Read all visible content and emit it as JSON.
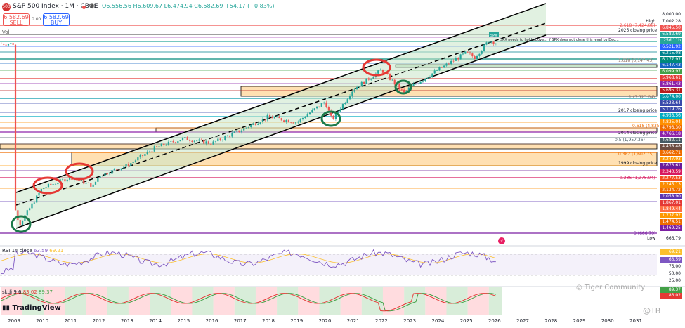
{
  "header": {
    "symbol_icon": "500",
    "title": "S&P 500 Index · 1M · CBOE",
    "ohlc": "O6,556.56  H6,609.67  L6,474.94  C6,582.69  +54.17 (+0.83%)",
    "eye_icon": "eye-icon"
  },
  "trade": {
    "sell_price": "6,582.69",
    "sell_label": "SELL",
    "spread": "0.00",
    "buy_price": "6,582.69",
    "buy_label": "BUY"
  },
  "volume_label": "Vol",
  "colors": {
    "up": "#26a69a",
    "down": "#ef5350",
    "channel": "#000000",
    "fill": "#c8e6c9",
    "fib": "#f57c00",
    "rsi": "#7e57c2"
  },
  "price_axis": {
    "high_label": "High",
    "high_value": "7,002.28",
    "low_label": "Low",
    "low_value": "666.79",
    "top_value": "8,000.00",
    "labels": [
      {
        "price": "6,845.50",
        "color": "#ef5350"
      },
      {
        "price": "6,582.69",
        "color": "#26a69a"
      },
      {
        "price": "25d 11h",
        "color": "#26a69a"
      },
      {
        "price": "6,521.92",
        "color": "#2962ff"
      },
      {
        "price": "6,215.08",
        "color": "#00838f"
      },
      {
        "price": "6,177.97",
        "color": "#00897b"
      },
      {
        "price": "6,147.43",
        "color": "#1565c0"
      },
      {
        "price": "6,099.97",
        "color": "#43a047"
      },
      {
        "price": "5,968.61",
        "color": "#e53935"
      },
      {
        "price": "5,861.43",
        "color": "#8e24aa"
      },
      {
        "price": "5,695.31",
        "color": "#b71c1c"
      },
      {
        "price": "5,674.00",
        "color": "#0097a7"
      },
      {
        "price": "5,523.64",
        "color": "#3949ab"
      },
      {
        "price": "5,119.26",
        "color": "#3949ab"
      },
      {
        "price": "4,953.56",
        "color": "#00acc1"
      },
      {
        "price": "4,835.04",
        "color": "#ff8f00"
      },
      {
        "price": "4,793.30",
        "color": "#ef6c00"
      },
      {
        "price": "4,766.18",
        "color": "#8e24aa"
      },
      {
        "price": "4,682.11",
        "color": "#455a64"
      },
      {
        "price": "4,458.48",
        "color": "#6d4c41"
      },
      {
        "price": "3,662.71",
        "color": "#ef6c00"
      },
      {
        "price": "3,247.93",
        "color": "#ff9800"
      },
      {
        "price": "2,673.61",
        "color": "#6a1b9a"
      },
      {
        "price": "2,340.59",
        "color": "#d81b60"
      },
      {
        "price": "2,277.53",
        "color": "#f4511e"
      },
      {
        "price": "2,245.13",
        "color": "#fb8c00"
      },
      {
        "price": "2,134.72",
        "color": "#ef6c00"
      },
      {
        "price": "2,058.90",
        "color": "#5e35b1"
      },
      {
        "price": "1,867.01",
        "color": "#e53935"
      },
      {
        "price": "1,849.44",
        "color": "#ff7043"
      },
      {
        "price": "1,737.92",
        "color": "#ff9800"
      },
      {
        "price": "1,474.51",
        "color": "#ef6c00"
      },
      {
        "price": "1,469.25",
        "color": "#7b1fa2"
      }
    ]
  },
  "chart_annotations": {
    "fib_2618": "2.618 (7,424.00)",
    "close_2025": "2025 closing price",
    "spx_tag": "SPX",
    "spx_note": "SPX needs to hold above... If SPX does not close this level by Dec...",
    "fib_1618": "1.618 (6,147.43)",
    "fib_1": "1 (5,523.64)",
    "close_2017": "2017 closing price",
    "fib_618": "0.618 (4,835.04)",
    "close_2014": "2014 closing price",
    "fib_05": "0.5 (1,957.36)",
    "fib_382": "0.382 (1,602.75)",
    "close_1999": "1999 closing price",
    "fib_236": "0.236 (1,275.94)",
    "fib_0": "0 (666.79)"
  },
  "rsi": {
    "label": "RSI 14 close",
    "v1": "63.59",
    "v2": "69.21",
    "tag1": "69.21",
    "tag2": "63.59",
    "axis": [
      "75.00",
      "50.00",
      "25.00"
    ]
  },
  "skdj": {
    "label": "skdj 9 6",
    "v1": "83.02",
    "v2": "89.37",
    "tag1": "89.37",
    "tag2": "83.02"
  },
  "branding": {
    "tv": "TradingView",
    "watermark": "Tiger Community",
    "handle": "@TB"
  },
  "chart_data": {
    "type": "candlestick",
    "title": "S&P 500 Index · 1M · CBOE",
    "x_ticks": [
      "2009",
      "2010",
      "2011",
      "2012",
      "2013",
      "2014",
      "2015",
      "2016",
      "2017",
      "2018",
      "2019",
      "2020",
      "2021",
      "2022",
      "2023",
      "2024",
      "2025",
      "2026",
      "2027",
      "2028",
      "2029",
      "2030",
      "2031"
    ],
    "x_range": [
      2008.5,
      2031.6
    ],
    "approx_yearly_close": [
      {
        "x": 2009.0,
        "y": 900
      },
      {
        "x": 2009.2,
        "y": 720
      },
      {
        "x": 2010.0,
        "y": 1120
      },
      {
        "x": 2011.0,
        "y": 1280
      },
      {
        "x": 2011.8,
        "y": 1150
      },
      {
        "x": 2012.0,
        "y": 1300
      },
      {
        "x": 2013.0,
        "y": 1480
      },
      {
        "x": 2014.0,
        "y": 1840
      },
      {
        "x": 2015.0,
        "y": 2060
      },
      {
        "x": 2016.0,
        "y": 1940
      },
      {
        "x": 2017.0,
        "y": 2270
      },
      {
        "x": 2018.0,
        "y": 2690
      },
      {
        "x": 2019.0,
        "y": 2510
      },
      {
        "x": 2020.0,
        "y": 3230
      },
      {
        "x": 2020.25,
        "y": 2580
      },
      {
        "x": 2021.0,
        "y": 3760
      },
      {
        "x": 2022.0,
        "y": 4770
      },
      {
        "x": 2022.8,
        "y": 3590
      },
      {
        "x": 2023.0,
        "y": 3840
      },
      {
        "x": 2024.0,
        "y": 4770
      },
      {
        "x": 2025.0,
        "y": 5880
      },
      {
        "x": 2025.3,
        "y": 5560
      },
      {
        "x": 2025.8,
        "y": 6830
      },
      {
        "x": 2026.2,
        "y": 6582.69
      }
    ],
    "last_close": 6582.69,
    "high": 7002.28,
    "low": 666.79
  }
}
